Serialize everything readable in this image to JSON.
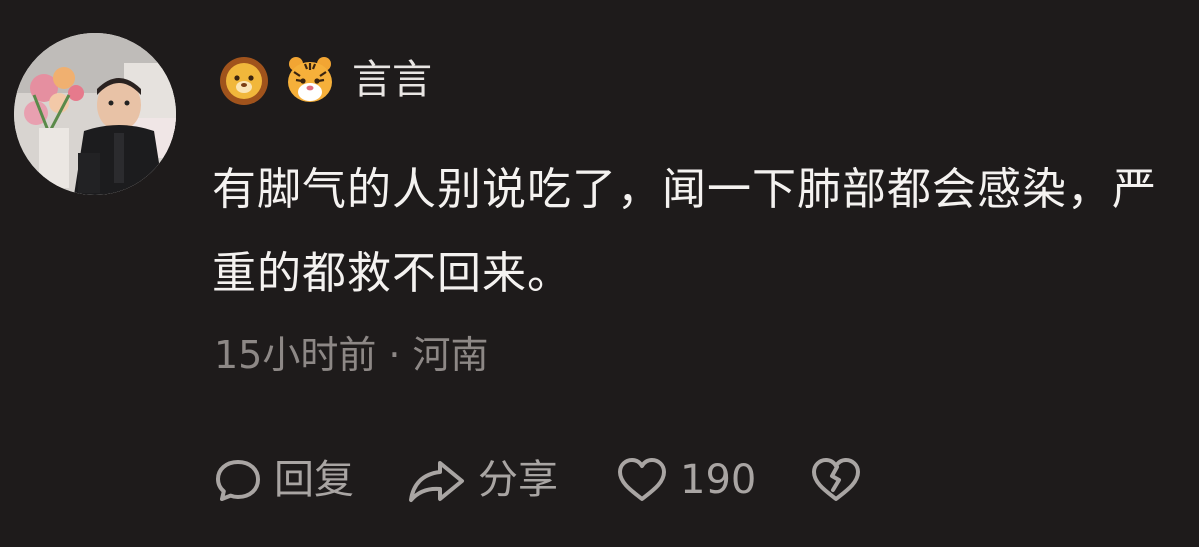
{
  "comment": {
    "username": "言言",
    "badges": [
      "lion-badge-icon",
      "tiger-badge-icon"
    ],
    "text": "有脚气的人别说吃了，闻一下肺部都会感染，严重的都救不回来。",
    "time": "15小时前",
    "separator": "·",
    "location": "河南",
    "actions": {
      "reply_label": "回复",
      "share_label": "分享",
      "like_count": "190"
    }
  },
  "colors": {
    "background": "#1e1b1b",
    "text": "#f4f2f0",
    "meta": "#8d8886",
    "action": "#a9a5a3"
  }
}
